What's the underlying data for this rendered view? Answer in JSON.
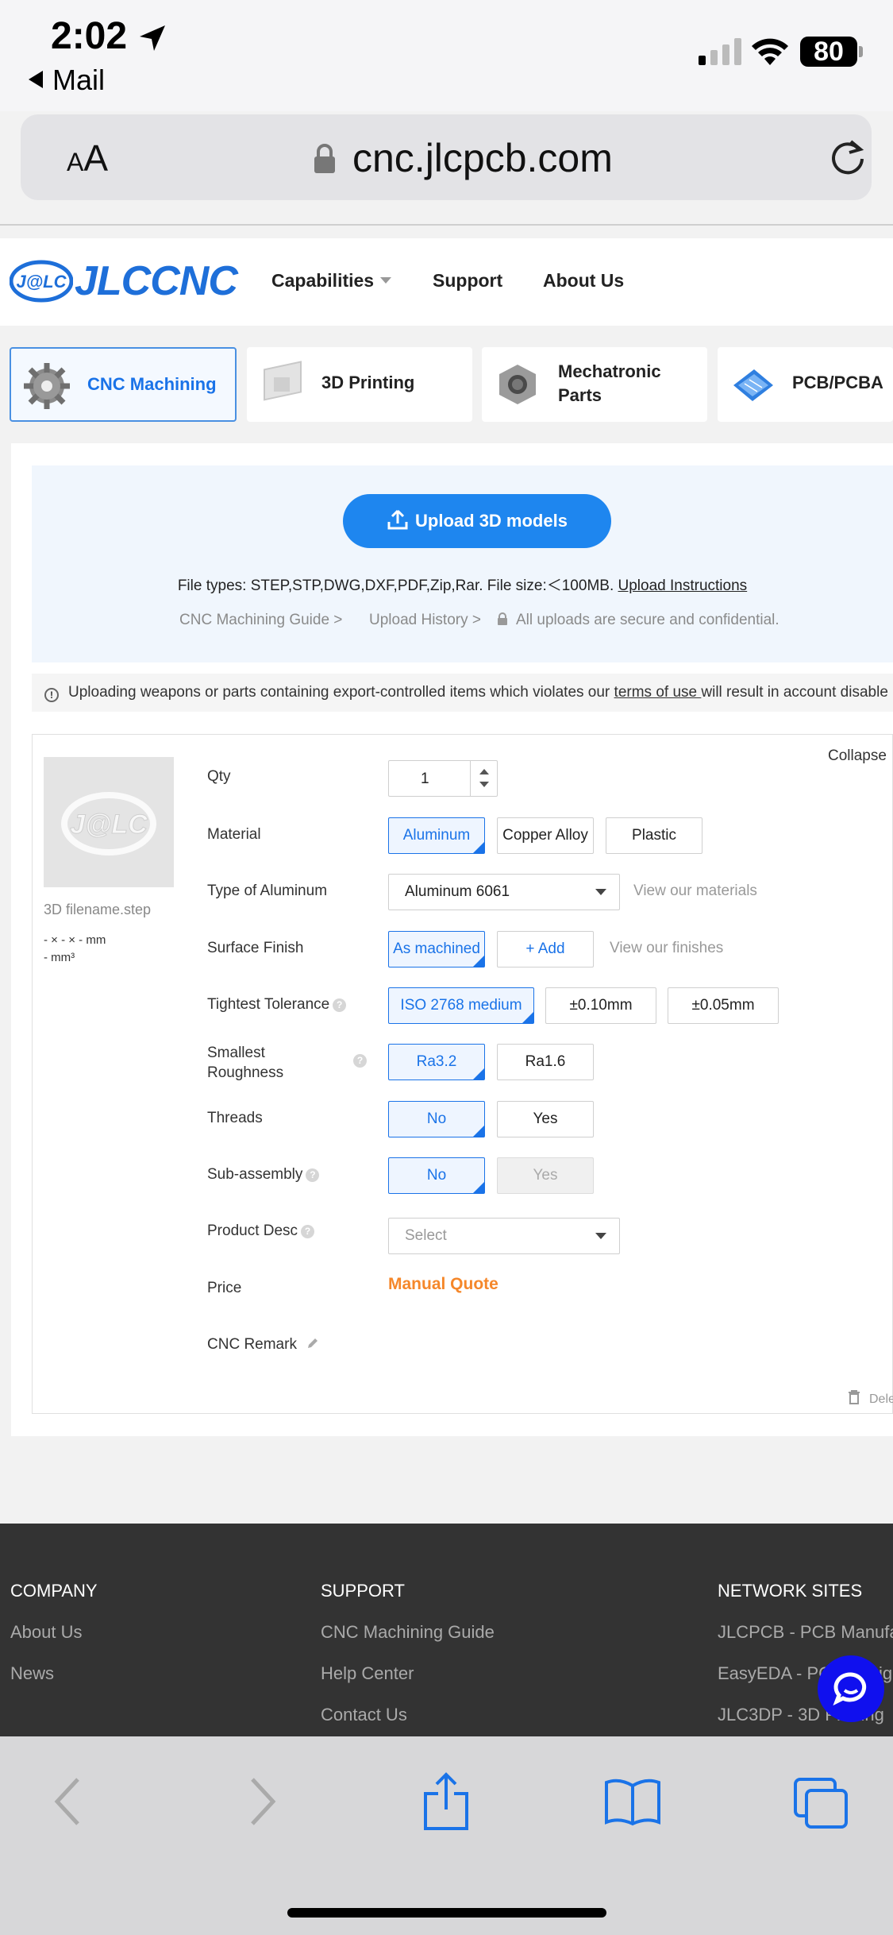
{
  "status": {
    "time": "2:02",
    "back_app": "Mail",
    "battery": "80"
  },
  "browser": {
    "text_size_label_small": "A",
    "text_size_label_big": "A",
    "url": "cnc.jlcpcb.com"
  },
  "site": {
    "logo_mark": "J@LC",
    "logo_text": "JLCCNC",
    "nav": [
      "Capabilities",
      "Support",
      "About Us"
    ]
  },
  "services": [
    {
      "label": "CNC Machining",
      "active": true
    },
    {
      "label": "3D Printing",
      "active": false
    },
    {
      "label": "Mechatronic Parts",
      "active": false
    },
    {
      "label": "PCB/PCBA",
      "active": false
    }
  ],
  "upload": {
    "button": "Upload 3D models",
    "file_types": "File types: STEP,STP,DWG,DXF,PDF,Zip,Rar. File size:＜100MB.",
    "instructions_link": "Upload Instructions",
    "guide_link": "CNC Machining Guide >",
    "history_link": "Upload History >",
    "secure_note": "All uploads are secure and confidential."
  },
  "warning": {
    "text_before": "Uploading weapons or parts containing export-controlled items which violates our ",
    "link": "terms of use ",
    "text_after": "will result in account disable"
  },
  "part": {
    "filename": "3D filename.step",
    "dims": "- × - × - mm",
    "volume": "- mm³",
    "collapse": "Collapse",
    "delete": "Dele",
    "qty_label": "Qty",
    "qty": "1",
    "material_label": "Material",
    "materials": [
      "Aluminum",
      "Copper Alloy",
      "Plastic"
    ],
    "type_label": "Type of Aluminum",
    "type_value": "Aluminum 6061",
    "view_materials": "View our materials",
    "finish_label": "Surface Finish",
    "finish_value": "As machined",
    "finish_add": "+ Add",
    "view_finishes": "View our finishes",
    "tolerance_label": "Tightest Tolerance",
    "tolerances": [
      "ISO 2768 medium",
      "±0.10mm",
      "±0.05mm"
    ],
    "roughness_label_1": "Smallest",
    "roughness_label_2": "Roughness",
    "roughness": [
      "Ra3.2",
      "Ra1.6"
    ],
    "threads_label": "Threads",
    "threads": [
      "No",
      "Yes"
    ],
    "subassembly_label": "Sub-assembly",
    "subassembly": [
      "No",
      "Yes"
    ],
    "desc_label": "Product Desc",
    "desc_placeholder": "Select",
    "price_label": "Price",
    "price_value": "Manual Quote",
    "remark_label": "CNC Remark"
  },
  "footer": {
    "company_heading": "COMPANY",
    "company_links": [
      "About Us",
      "News"
    ],
    "support_heading": "SUPPORT",
    "support_links": [
      "CNC Machining Guide",
      "Help Center",
      "Contact Us"
    ],
    "network_heading": "NETWORK SITES",
    "network_links": [
      "JLCPCB - PCB Manufa",
      "EasyEDA - PCB Desig",
      "JLC3DP - 3D Printing"
    ]
  },
  "colors": {
    "accent": "#1a73e8",
    "price": "#f5872a",
    "footer": "#333333",
    "upload_button": "#1e86ef"
  }
}
